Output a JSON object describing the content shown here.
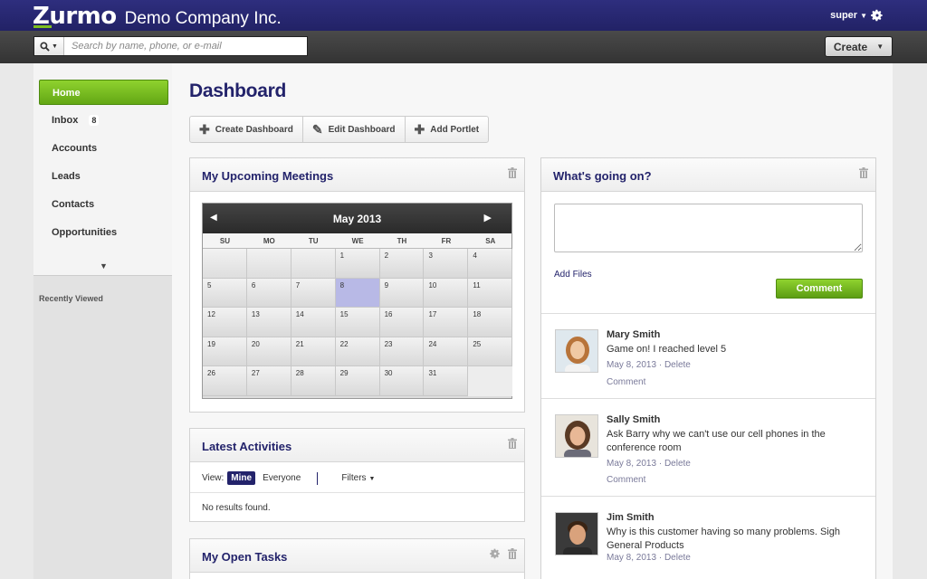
{
  "app": {
    "brand": "Zurmo",
    "company": "Demo Company Inc.",
    "user": "super"
  },
  "search": {
    "placeholder": "Search by name, phone, or e-mail"
  },
  "create_label": "Create",
  "sidebar": {
    "items": [
      {
        "label": "Home"
      },
      {
        "label": "Inbox",
        "badge": "8"
      },
      {
        "label": "Accounts"
      },
      {
        "label": "Leads"
      },
      {
        "label": "Contacts"
      },
      {
        "label": "Opportunities"
      }
    ],
    "recently_viewed": "Recently Viewed"
  },
  "page_title": "Dashboard",
  "toolbar": {
    "create": "Create Dashboard",
    "edit": "Edit Dashboard",
    "add": "Add Portlet"
  },
  "meetings": {
    "title": "My Upcoming Meetings",
    "month": "May 2013",
    "days": [
      "SU",
      "MO",
      "TU",
      "WE",
      "TH",
      "FR",
      "SA"
    ],
    "dates": [
      "",
      "",
      "",
      "1",
      "2",
      "3",
      "4",
      "5",
      "6",
      "7",
      "8",
      "9",
      "10",
      "11",
      "12",
      "13",
      "14",
      "15",
      "16",
      "17",
      "18",
      "19",
      "20",
      "21",
      "22",
      "23",
      "24",
      "25",
      "26",
      "27",
      "28",
      "29",
      "30",
      "31",
      ""
    ],
    "today": "8"
  },
  "activities": {
    "title": "Latest Activities",
    "view_label": "View:",
    "mine": "Mine",
    "everyone": "Everyone",
    "filters": "Filters",
    "empty": "No results found."
  },
  "tasks": {
    "title": "My Open Tasks"
  },
  "social": {
    "title": "What's going on?",
    "add_files": "Add Files",
    "comment_btn": "Comment",
    "feed": [
      {
        "name": "Mary Smith",
        "text": "Game on! I reached level 5",
        "date": "May 8, 2013",
        "delete": "Delete",
        "comment": "Comment"
      },
      {
        "name": "Sally Smith",
        "text": "Ask Barry why we can't use our cell phones in the conference room",
        "date": "May 8, 2013",
        "delete": "Delete",
        "comment": "Comment"
      },
      {
        "name": "Jim Smith",
        "text": "Why is this customer having so many problems. Sigh General Products",
        "date": "May 8, 2013",
        "delete": "Delete"
      }
    ]
  },
  "colors": {
    "header": "#27276f",
    "accent_green": "#6fb51c",
    "title_blue": "#23236b"
  }
}
